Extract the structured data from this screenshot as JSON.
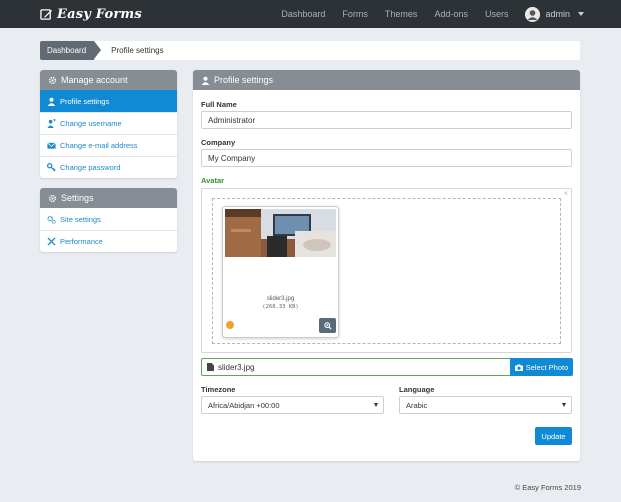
{
  "navbar": {
    "brand": "Easy Forms",
    "links": [
      "Dashboard",
      "Forms",
      "Themes",
      "Add-ons",
      "Users"
    ],
    "user": "admin"
  },
  "breadcrumb": {
    "home": "Dashboard",
    "current": "Profile settings"
  },
  "sidebar": {
    "manage_account": {
      "title": "Manage account",
      "items": [
        {
          "label": "Profile settings",
          "icon": "user-icon"
        },
        {
          "label": "Change username",
          "icon": "user-edit-icon"
        },
        {
          "label": "Change e-mail address",
          "icon": "envelope-icon"
        },
        {
          "label": "Change password",
          "icon": "key-icon"
        }
      ]
    },
    "settings": {
      "title": "Settings",
      "items": [
        {
          "label": "Site settings",
          "icon": "cogs-icon"
        },
        {
          "label": "Performance",
          "icon": "wrench-icon"
        }
      ]
    }
  },
  "profile": {
    "title": "Profile settings",
    "full_name_label": "Full Name",
    "full_name_value": "Administrator",
    "company_label": "Company",
    "company_value": "My Company",
    "avatar_label": "Avatar",
    "file_name": "slider3.jpg",
    "file_size": "(268.33 KB)",
    "selected_file": "slider3.jpg",
    "select_photo": "Select Photo",
    "timezone_label": "Timezone",
    "timezone_value": "Africa/Abidjan +00:00",
    "language_label": "Language",
    "language_value": "Arabic",
    "update_button": "Update"
  },
  "footer": "© Easy Forms 2019",
  "colors": {
    "navbar": "#2d3237",
    "accent": "#118ad6",
    "panel_header": "#868d94",
    "avatar_label": "#3a8e3a"
  }
}
